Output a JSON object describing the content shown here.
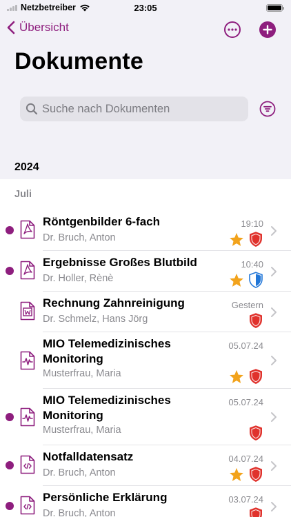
{
  "status_bar": {
    "carrier": "Netzbetreiber",
    "time": "23:05"
  },
  "nav": {
    "back_label": "Übersicht"
  },
  "page": {
    "title": "Dokumente"
  },
  "search": {
    "placeholder": "Suche nach Dokumenten"
  },
  "sections": {
    "year": "2024",
    "month": "Juli"
  },
  "colors": {
    "accent": "#8e1e7e",
    "star": "#f2a31c",
    "shield_red": "#e0322c",
    "shield_blue": "#2277d8"
  },
  "documents": [
    {
      "title": "Röntgenbilder 6-fach",
      "author": "Dr. Bruch, Anton",
      "date": "19:10",
      "icon": "pdf-icon",
      "unread": true,
      "starred": true,
      "shield": "red"
    },
    {
      "title": "Ergebnisse Großes Blutbild",
      "author": "Dr. Holler, Rènè",
      "date": "10:40",
      "icon": "pdf-icon",
      "unread": true,
      "starred": true,
      "shield": "blue"
    },
    {
      "title": "Rechnung Zahnreinigung",
      "author": "Dr. Schmelz, Hans Jörg",
      "date": "Gestern",
      "icon": "word-icon",
      "unread": false,
      "starred": false,
      "shield": "red"
    },
    {
      "title": "MIO Telemedizinisches Monitoring",
      "author": "Musterfrau, Maria",
      "date": "05.07.24",
      "icon": "monitoring-icon",
      "unread": false,
      "starred": true,
      "shield": "red"
    },
    {
      "title": "MIO Telemedizinisches Monitoring",
      "author": "Musterfrau, Maria",
      "date": "05.07.24",
      "icon": "monitoring-icon",
      "unread": true,
      "starred": false,
      "shield": "red"
    },
    {
      "title": "Notfalldatensatz",
      "author": "Dr. Bruch, Anton",
      "date": "04.07.24",
      "icon": "code-icon",
      "unread": true,
      "starred": true,
      "shield": "red"
    },
    {
      "title": "Persönliche Erklärung",
      "author": "Dr. Bruch, Anton",
      "date": "03.07.24",
      "icon": "code-icon",
      "unread": true,
      "starred": false,
      "shield": "red"
    }
  ]
}
